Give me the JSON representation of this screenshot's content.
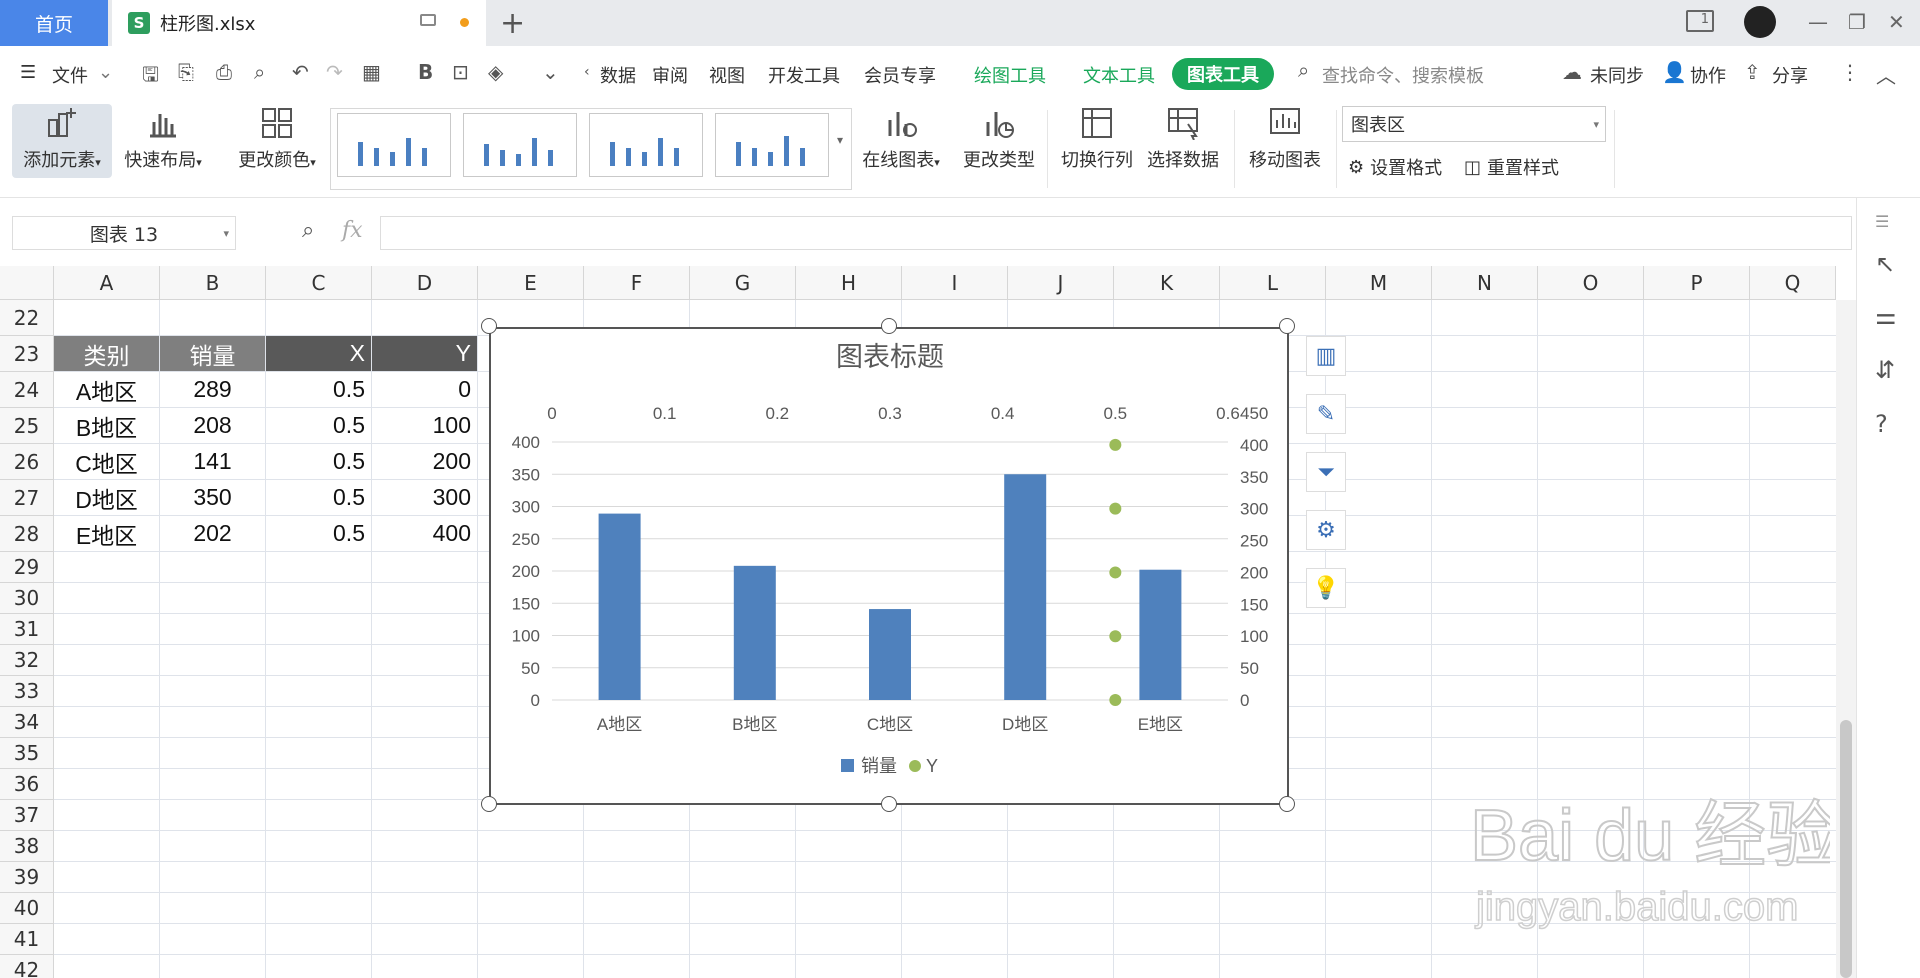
{
  "tabs": {
    "home": "首页",
    "file": "柱形图.xlsx",
    "file_icon": "S"
  },
  "menu": {
    "file": "文件",
    "items": [
      "数据",
      "审阅",
      "视图",
      "开发工具",
      "会员专享"
    ],
    "drawing_tools": "绘图工具",
    "text_tools": "文本工具",
    "chart_tools": "图表工具",
    "search_placeholder": "查找命令、搜索模板",
    "sync": "未同步",
    "collab": "协作",
    "share": "分享"
  },
  "ribbon": {
    "add_element": "添加元素",
    "quick_layout": "快速布局",
    "change_color": "更改颜色",
    "online_chart": "在线图表",
    "change_type": "更改类型",
    "switch_rowcol": "切换行列",
    "select_data": "选择数据",
    "move_chart": "移动图表",
    "area_select": "图表区",
    "set_format": "设置格式",
    "reset_style": "重置样式"
  },
  "formula": {
    "namebox": "图表 13",
    "fx": "fx",
    "value": ""
  },
  "grid": {
    "columns": [
      "A",
      "B",
      "C",
      "D",
      "E",
      "F",
      "G",
      "H",
      "I",
      "J",
      "K",
      "L",
      "M",
      "N",
      "O",
      "P",
      "Q"
    ],
    "rows": [
      "22",
      "23",
      "24",
      "25",
      "26",
      "27",
      "28",
      "29",
      "30",
      "31",
      "32",
      "33",
      "34",
      "35",
      "36",
      "37",
      "38",
      "39",
      "40",
      "41",
      "42"
    ],
    "header": [
      "类别",
      "销量",
      "X",
      "Y"
    ],
    "data": [
      [
        "A地区",
        "289",
        "0.5",
        "0"
      ],
      [
        "B地区",
        "208",
        "0.5",
        "100"
      ],
      [
        "C地区",
        "141",
        "0.5",
        "200"
      ],
      [
        "D地区",
        "350",
        "0.5",
        "300"
      ],
      [
        "E地区",
        "202",
        "0.5",
        "400"
      ]
    ]
  },
  "chart_data": {
    "type": "bar",
    "title": "图表标题",
    "categories": [
      "A地区",
      "B地区",
      "C地区",
      "D地区",
      "E地区"
    ],
    "series": [
      {
        "name": "销量",
        "type": "bar",
        "values": [
          289,
          208,
          141,
          350,
          202
        ],
        "color": "#4f81bd",
        "axis": "primary"
      },
      {
        "name": "Y",
        "type": "scatter",
        "x": [
          0.5,
          0.5,
          0.5,
          0.5,
          0.5
        ],
        "y": [
          0,
          100,
          200,
          300,
          400
        ],
        "color": "#9bbb59",
        "axis": "secondary"
      }
    ],
    "y_primary": {
      "min": 0,
      "max": 400,
      "ticks": [
        "0",
        "50",
        "100",
        "150",
        "200",
        "250",
        "300",
        "350",
        "400"
      ]
    },
    "y_secondary": {
      "min": 0,
      "max": 450,
      "ticks": [
        "0",
        "50",
        "100",
        "150",
        "200",
        "250",
        "300",
        "350",
        "400",
        "450"
      ]
    },
    "x_secondary": {
      "min": 0,
      "max": 0.6,
      "ticks": [
        "0",
        "0.1",
        "0.2",
        "0.3",
        "0.4",
        "0.5",
        "0.6"
      ]
    },
    "legend": "bottom",
    "grid": true
  },
  "watermark": {
    "line1": "Bai du 经验",
    "line2": "jingyan.baidu.com"
  },
  "colors": {
    "accent": "#1aa85a",
    "home_tab": "#4a86e8",
    "bar": "#4f81bd",
    "point": "#9bbb59"
  }
}
